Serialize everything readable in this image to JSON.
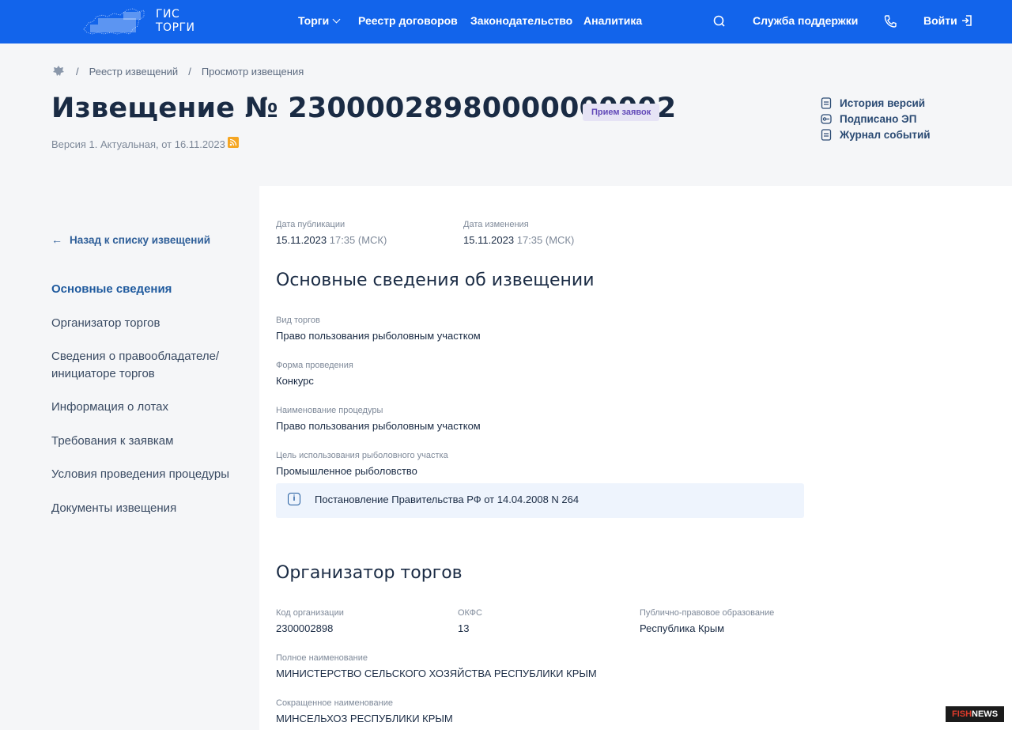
{
  "topbar": {
    "logo_line1": "ГИС",
    "logo_line2": "ТОРГИ",
    "nav": [
      "Торги",
      "Реестр договоров",
      "Законодательство",
      "Аналитика"
    ],
    "support": "Служба поддержки",
    "login": "Войти",
    "icons": [
      "search-icon",
      "phone-icon",
      "login-icon",
      "chevron-down-icon"
    ]
  },
  "breadcrumb": {
    "home_icon": "emblem-icon",
    "items": [
      "Реестр извещений",
      "Просмотр извещения"
    ],
    "separator": "/"
  },
  "header": {
    "title": "Извещение № 23000028980000000002",
    "status": "Прием заявок",
    "version": "Версия 1. Актуальная, от 16.11.2023",
    "links": [
      "История версий",
      "Подписано ЭП",
      "Журнал событий"
    ]
  },
  "sidebar": {
    "back": "Назад к списку извещений",
    "items": [
      "Основные сведения",
      "Организатор торгов",
      "Сведения о правообладателе/ инициаторе торгов",
      "Информация о лотах",
      "Требования к заявкам",
      "Условия проведения процедуры",
      "Документы извещения"
    ]
  },
  "dates": {
    "published_label": "Дата публикации",
    "published_date": "15.11.2023",
    "published_time": "17:35 (МСК)",
    "changed_label": "Дата изменения",
    "changed_date": "15.11.2023",
    "changed_time": "17:35 (МСК)"
  },
  "basic": {
    "title": "Основные сведения об извещении",
    "fields": [
      {
        "label": "Вид торгов",
        "value": "Право пользования рыболовным участком"
      },
      {
        "label": "Форма проведения",
        "value": "Конкурс"
      },
      {
        "label": "Наименование процедуры",
        "value": "Право пользования рыболовным участком"
      },
      {
        "label": "Цель использования рыболовного участка",
        "value": "Промышленное рыболовство"
      }
    ],
    "info": "Постановление Правительства РФ от 14.04.2008 N 264"
  },
  "organizer": {
    "title": "Организатор торгов",
    "code_label": "Код организации",
    "code": "2300002898",
    "okfs_label": "ОКФС",
    "okfs": "13",
    "ppo_label": "Публично-правовое образование",
    "ppo": "Республика Крым",
    "full_label": "Полное наименование",
    "full": "МИНИСТЕРСТВО СЕЛЬСКОГО ХОЗЯЙСТВА РЕСПУБЛИКИ КРЫМ",
    "short_label": "Сокращенное наименование",
    "short": "МИНСЕЛЬХОЗ РЕСПУБЛИКИ КРЫМ"
  },
  "watermark": {
    "part1": "FISH",
    "part2": "NEWS"
  },
  "colors": {
    "topbar": "#1264eb",
    "accent": "#1f5a9e",
    "badge_bg": "#e6e3f5",
    "badge_text": "#6249b8"
  }
}
